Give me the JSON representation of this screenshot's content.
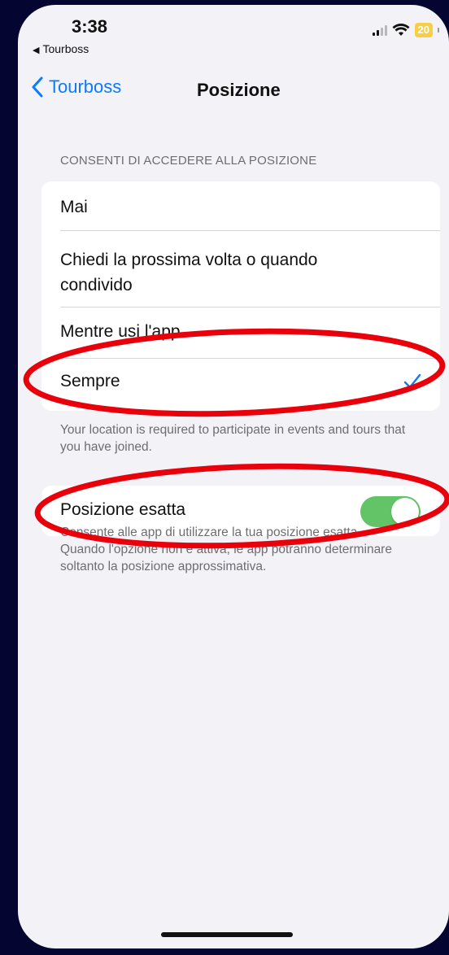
{
  "status_bar": {
    "time": "3:38",
    "back_app_label": "Tourboss",
    "battery_level": "20",
    "signal_icon": "signal-bars-icon",
    "wifi_icon": "wifi-icon"
  },
  "nav": {
    "back_label": "Tourboss",
    "title": "Posizione"
  },
  "location_access": {
    "header": "CONSENTI DI ACCEDERE ALLA POSIZIONE",
    "options": [
      {
        "label": "Mai",
        "selected": false
      },
      {
        "label": "Chiedi la prossima volta o quando condivido",
        "selected": false
      },
      {
        "label": "Mentre usi l'app",
        "selected": false
      },
      {
        "label": "Sempre",
        "selected": true
      }
    ],
    "footer": "Your location is required to participate in events and tours that you have joined."
  },
  "precise_location": {
    "label": "Posizione esatta",
    "enabled": true,
    "footer": "Consente alle app di utilizzare la tua posizione esatta. Quando l'opzione non è attiva, le app potranno determinare soltanto la posizione approssimativa."
  },
  "colors": {
    "accent": "#0a7aff",
    "toggle_on": "#63c467",
    "annotation": "#e8000b",
    "background": "#050531"
  }
}
